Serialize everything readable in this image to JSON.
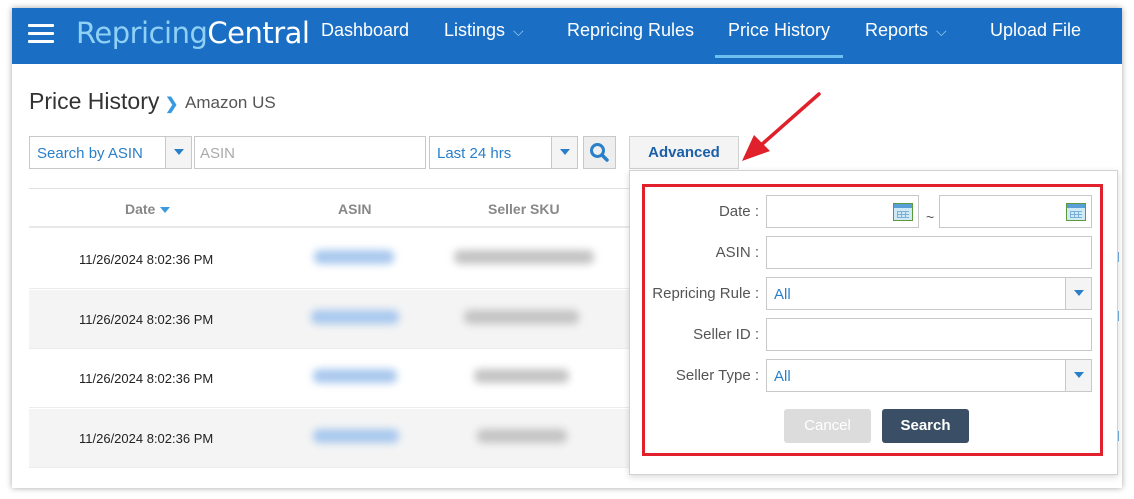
{
  "app": {
    "logo_part1": "Repricing",
    "logo_part2": "Central"
  },
  "nav": {
    "items": [
      {
        "label": "Dashboard"
      },
      {
        "label": "Listings"
      },
      {
        "label": "Repricing Rules"
      },
      {
        "label": "Price History"
      },
      {
        "label": "Reports"
      },
      {
        "label": "Upload File"
      }
    ],
    "active": "Price History"
  },
  "page": {
    "title": "Price History",
    "breadcrumb": "Amazon US"
  },
  "filters": {
    "search_by": "Search by ASIN",
    "asin_placeholder": "ASIN",
    "period": "Last 24 hrs",
    "advanced_label": "Advanced"
  },
  "table": {
    "columns": [
      "Date",
      "ASIN",
      "Seller SKU"
    ],
    "rows": [
      {
        "date": "11/26/2024 8:02:36 PM"
      },
      {
        "date": "11/26/2024 8:02:36 PM"
      },
      {
        "date": "11/26/2024 8:02:36 PM"
      },
      {
        "date": "11/26/2024 8:02:36 PM"
      }
    ]
  },
  "advanced": {
    "date_label": "Date :",
    "date_sep": "~",
    "asin_label": "ASIN :",
    "rule_label": "Repricing Rule :",
    "rule_value": "All",
    "seller_id_label": "Seller ID :",
    "seller_type_label": "Seller Type :",
    "seller_type_value": "All",
    "cancel_label": "Cancel",
    "search_label": "Search"
  },
  "icons": {
    "menu": "hamburger-icon",
    "breadcrumb": "chevron-right-icon",
    "search": "magnifier-icon",
    "calendar": "calendar-icon",
    "annotation": "red-arrow-icon"
  },
  "colors": {
    "nav": "#1a6fc4",
    "accent": "#2a7fc9",
    "highlight": "#e0202a",
    "primary_button": "#3a4f65"
  }
}
